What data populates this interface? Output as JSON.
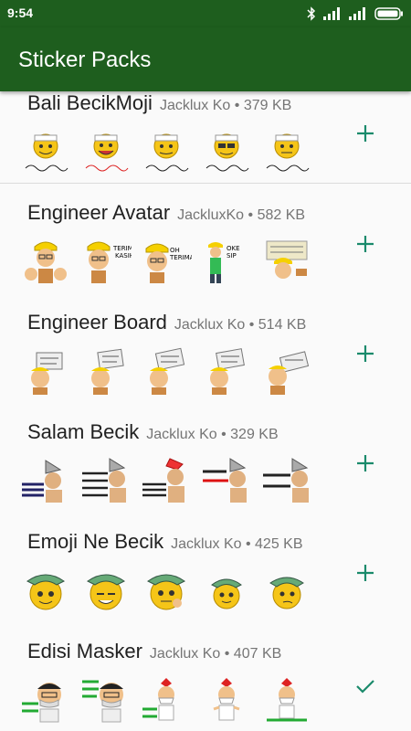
{
  "status": {
    "time": "9:54"
  },
  "app": {
    "title": "Sticker Packs"
  },
  "packs": [
    {
      "name": "Bali BecikMoji",
      "author": "Jacklux Ko",
      "size": "379 KB",
      "action": "add-icon"
    },
    {
      "name": "Engineer Avatar",
      "author": "JackluxKo",
      "size": "582 KB",
      "action": "add-icon"
    },
    {
      "name": "Engineer Board",
      "author": "Jacklux Ko",
      "size": "514 KB",
      "action": "add-icon"
    },
    {
      "name": "Salam Becik",
      "author": "Jacklux Ko",
      "size": "329 KB",
      "action": "add-icon"
    },
    {
      "name": "Emoji Ne Becik",
      "author": "Jacklux Ko",
      "size": "425 KB",
      "action": "add-icon"
    },
    {
      "name": "Edisi Masker",
      "author": "Jacklux Ko",
      "size": "407 KB",
      "action": "check-icon"
    }
  ],
  "colors": {
    "appbar": "#1e5e1e",
    "accent": "#1a8a6b"
  }
}
